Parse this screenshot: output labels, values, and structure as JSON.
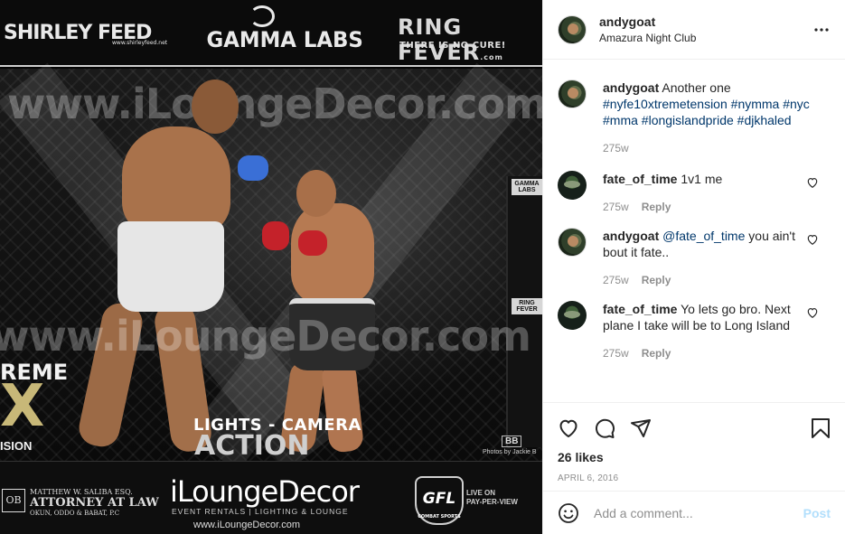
{
  "photo": {
    "sponsors_top": {
      "shirley": "SHIRLEY FEED",
      "shirley_url": "www.shirleyfeed.net",
      "gamma": "GAMMA LABS",
      "ring_fever": "RING FEVER",
      "ring_fever_tld": ".com",
      "ring_fever_sub": "THERE IS NO CURE!"
    },
    "watermark": "www.iLoungeDecor.com",
    "cage_labels": [
      "GAMMA LABS",
      "RING FEVER"
    ],
    "extreme_top": "REME",
    "extreme_x": "X",
    "extreme_sub": "ISION",
    "lights": "LIGHTS - CAMERA",
    "action": "ACTION",
    "credit": "Photos by Jackie B",
    "badge": "BB",
    "sponsors_bottom": {
      "ob": "OB",
      "attorney_name": "MATTHEW W. SALIBA ESQ.",
      "attorney_title": "ATTORNEY AT LAW",
      "attorney_firm": "OKUN, ODDO & BABAT, P.C",
      "ilounge": "iLoungeDecor",
      "ilounge_tag": "EVENT RENTALS | LIGHTING & LOUNGE",
      "ilounge_url": "www.iLoungeDecor.com",
      "gfl": "GFL",
      "gfl_sub": "COMBAT SPORTS",
      "ppv_1": "LIVE ON",
      "ppv_2": "PAY-PER-VIEW"
    }
  },
  "header": {
    "username": "andygoat",
    "location": "Amazura Night Club"
  },
  "caption": {
    "username": "andygoat",
    "text": "Another one",
    "hashtags": [
      "#nyfe10xtremetension",
      "#nymma",
      "#nyc",
      "#mma",
      "#longislandpride",
      "#djkhaled"
    ],
    "time": "275w"
  },
  "comments": [
    {
      "username": "fate_of_time",
      "text": "1v1 me",
      "mention": "",
      "time": "275w",
      "reply": "Reply"
    },
    {
      "username": "andygoat",
      "mention": "@fate_of_time",
      "text": "you ain't bout it fate..",
      "time": "275w",
      "reply": "Reply"
    },
    {
      "username": "fate_of_time",
      "text": "Yo lets go bro. Next plane I take will be to Long Island",
      "mention": "",
      "time": "275w",
      "reply": "Reply"
    }
  ],
  "actions": {
    "likes": "26 likes",
    "date": "APRIL 6, 2016"
  },
  "add_comment": {
    "placeholder": "Add a comment...",
    "post": "Post"
  },
  "colors": {
    "text": "#262626",
    "secondary": "#8e8e8e",
    "link": "#00376b",
    "post_disabled": "#b2dffc",
    "border": "#efefef"
  },
  "icons": [
    "more-icon",
    "heart-icon",
    "comment-icon",
    "share-icon",
    "bookmark-icon",
    "emoji-icon"
  ]
}
